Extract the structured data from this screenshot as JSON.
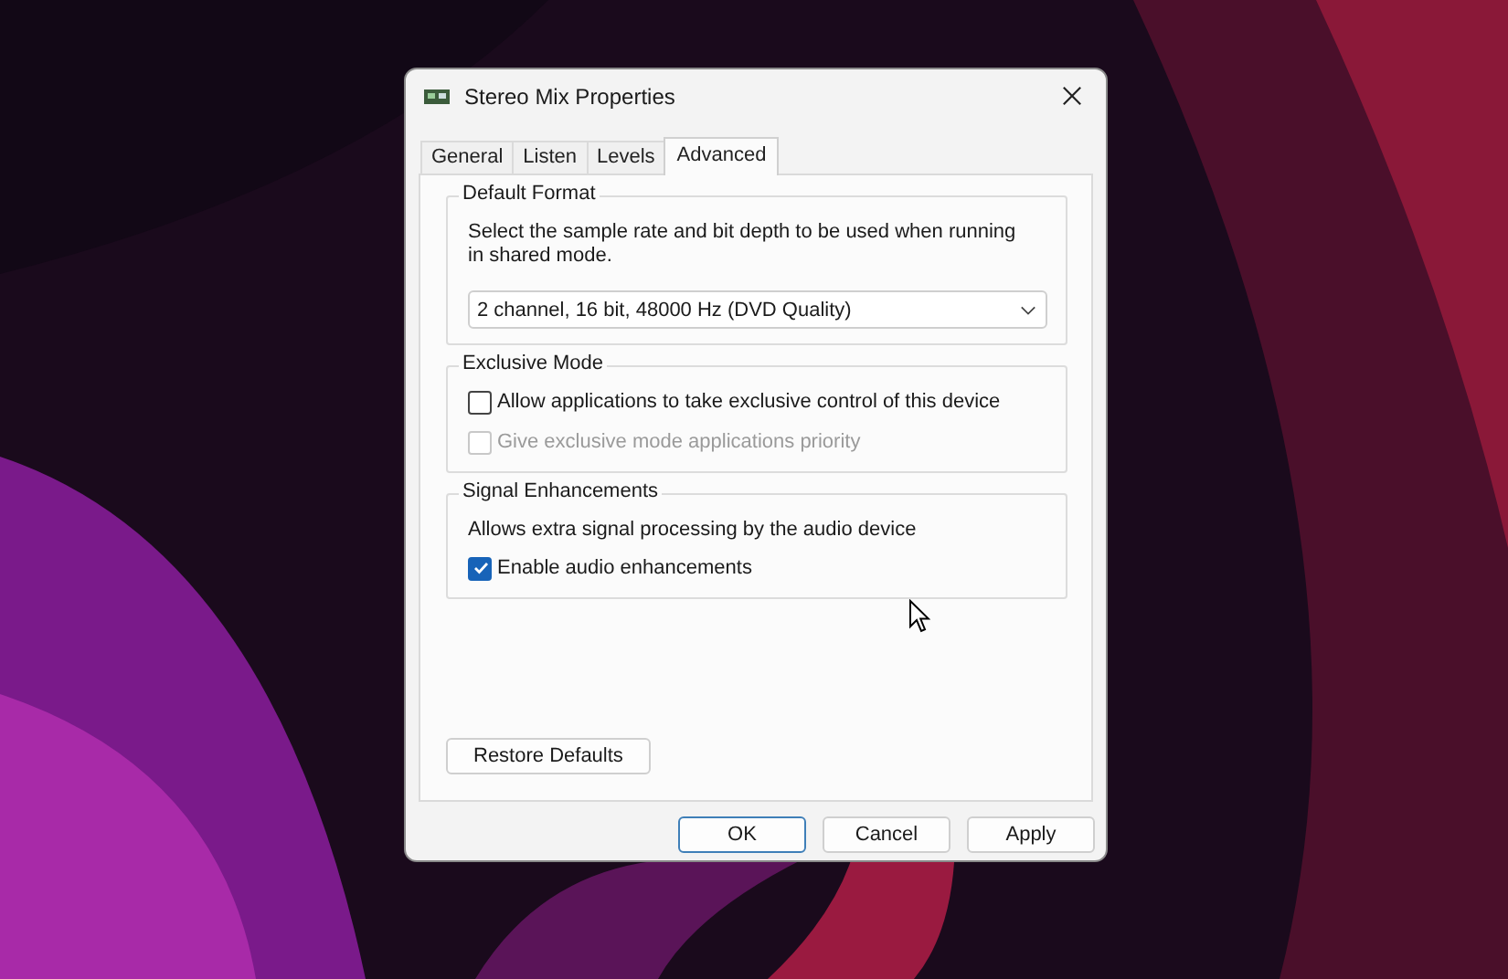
{
  "window": {
    "title": "Stereo Mix Properties"
  },
  "tabs": [
    {
      "label": "General",
      "selected": false
    },
    {
      "label": "Listen",
      "selected": false
    },
    {
      "label": "Levels",
      "selected": false
    },
    {
      "label": "Advanced",
      "selected": true
    }
  ],
  "groups": [
    {
      "title": "Default Format",
      "items": [
        {
          "kind": "text",
          "text": "Select the sample rate and bit depth to be used when running in shared mode."
        },
        {
          "kind": "dropdown",
          "value": "2 channel, 16 bit, 48000 Hz (DVD Quality)"
        }
      ]
    },
    {
      "title": "Exclusive Mode",
      "items": [
        {
          "kind": "checkbox",
          "label": "Allow applications to take exclusive control of this device",
          "checked": false,
          "disabled": false
        },
        {
          "kind": "checkbox",
          "label": "Give exclusive mode applications priority",
          "checked": false,
          "disabled": true
        }
      ]
    },
    {
      "title": "Signal Enhancements",
      "items": [
        {
          "kind": "text",
          "text": "Allows extra signal processing by the audio device"
        },
        {
          "kind": "checkbox",
          "label": "Enable audio enhancements",
          "checked": true,
          "disabled": false
        }
      ]
    }
  ],
  "restore_button": "Restore Defaults",
  "buttons": [
    {
      "label": "OK",
      "default": true
    },
    {
      "label": "Cancel",
      "default": false
    },
    {
      "label": "Apply",
      "default": false
    }
  ]
}
